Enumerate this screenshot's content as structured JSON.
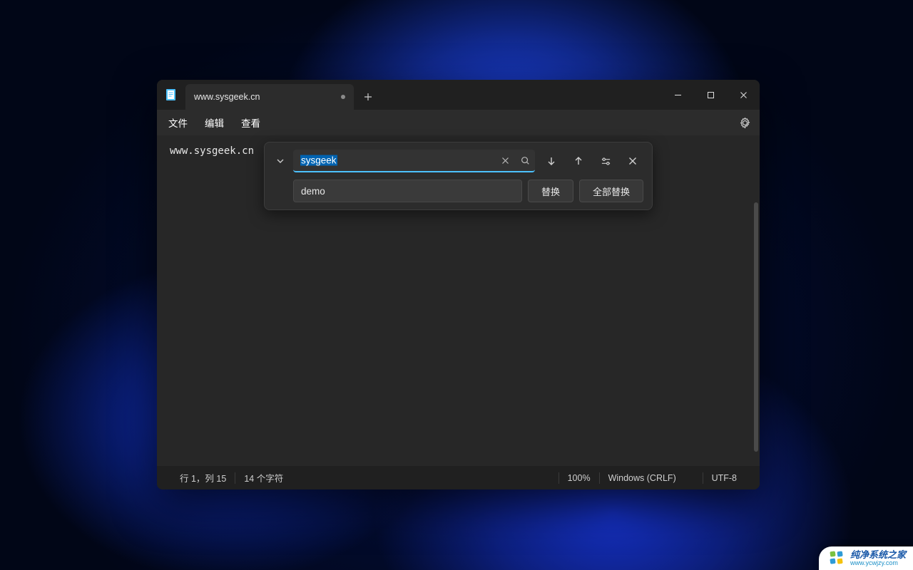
{
  "titlebar": {
    "tab_title": "www.sysgeek.cn"
  },
  "menubar": {
    "file": "文件",
    "edit": "编辑",
    "view": "查看"
  },
  "document": {
    "text": "www.sysgeek.cn"
  },
  "find_replace": {
    "search_value": "sysgeek",
    "replace_value": "demo",
    "replace_label": "替换",
    "replace_all_label": "全部替换"
  },
  "statusbar": {
    "position": "行 1，列 15",
    "chars": "14 个字符",
    "zoom": "100%",
    "line_ending": "Windows (CRLF)",
    "encoding": "UTF-8"
  },
  "watermark": {
    "cn": "纯净系统之家",
    "en": "www.ycwjzy.com"
  }
}
